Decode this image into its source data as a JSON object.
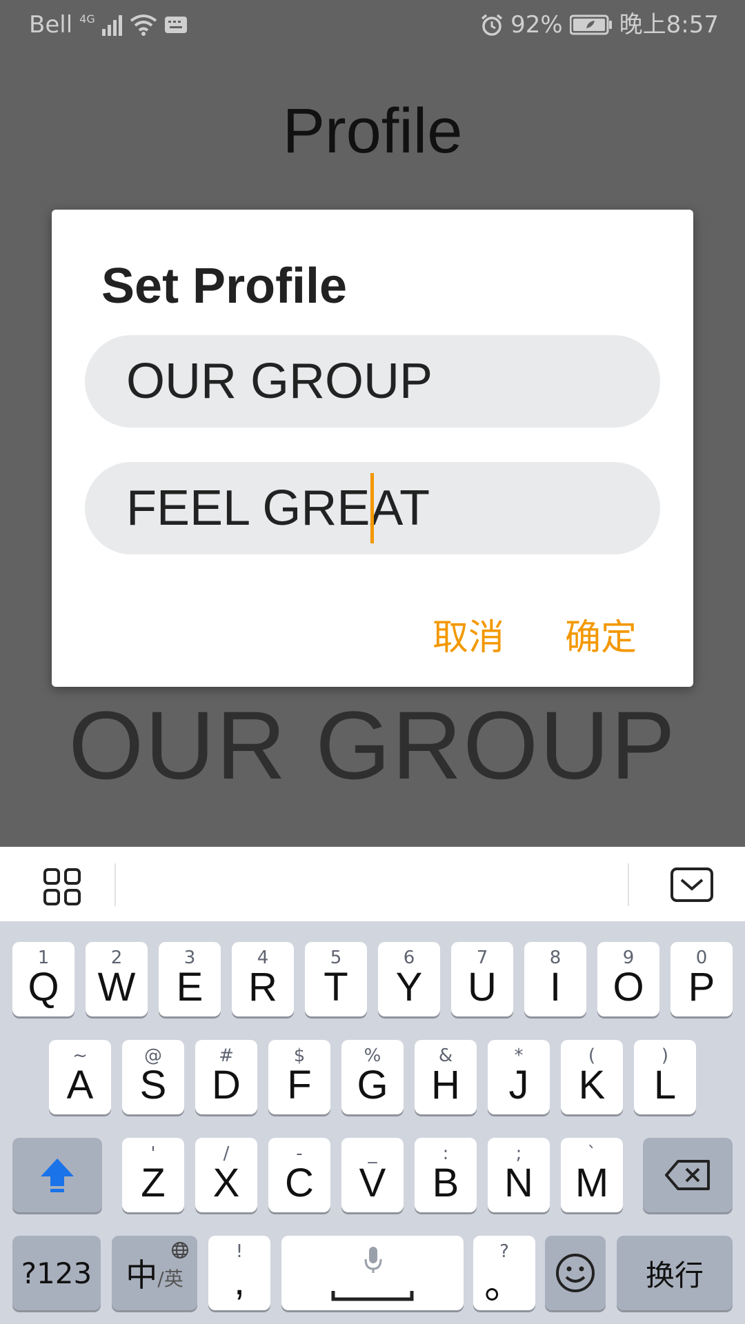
{
  "status_bar": {
    "carrier": "Bell",
    "network": "4G",
    "battery_percent": "92%",
    "time": "晚上8:57",
    "icons": [
      "signal-icon",
      "wifi-icon",
      "keyboard-notification-icon",
      "alarm-icon",
      "battery-icon"
    ]
  },
  "page": {
    "title": "Profile",
    "profile_text": "OUR GROUP"
  },
  "dialog": {
    "title": "Set Profile",
    "field_1_value": "OUR GROUP",
    "field_2_value": "FEEL GREAT",
    "cancel_label": "取消",
    "ok_label": "确定"
  },
  "colors": {
    "accent": "#f39800",
    "field_background": "#e8eaec",
    "overlay": "#626262",
    "shift_active": "#1a73e8"
  },
  "keyboard": {
    "toolbar_icons": [
      "grid-icon",
      "hide-keyboard-icon"
    ],
    "row1": [
      {
        "main": "Q",
        "sub": "1"
      },
      {
        "main": "W",
        "sub": "2"
      },
      {
        "main": "E",
        "sub": "3"
      },
      {
        "main": "R",
        "sub": "4"
      },
      {
        "main": "T",
        "sub": "5"
      },
      {
        "main": "Y",
        "sub": "6"
      },
      {
        "main": "U",
        "sub": "7"
      },
      {
        "main": "I",
        "sub": "8"
      },
      {
        "main": "O",
        "sub": "9"
      },
      {
        "main": "P",
        "sub": "0"
      }
    ],
    "row2": [
      {
        "main": "A",
        "sub": "~"
      },
      {
        "main": "S",
        "sub": "@"
      },
      {
        "main": "D",
        "sub": "#"
      },
      {
        "main": "F",
        "sub": "$"
      },
      {
        "main": "G",
        "sub": "%"
      },
      {
        "main": "H",
        "sub": "&"
      },
      {
        "main": "J",
        "sub": "*"
      },
      {
        "main": "K",
        "sub": "("
      },
      {
        "main": "L",
        "sub": ")"
      }
    ],
    "row3": [
      {
        "main": "Z",
        "sub": "'"
      },
      {
        "main": "X",
        "sub": "/"
      },
      {
        "main": "C",
        "sub": "-"
      },
      {
        "main": "V",
        "sub": "_"
      },
      {
        "main": "B",
        "sub": ":"
      },
      {
        "main": "N",
        "sub": ";"
      },
      {
        "main": "M",
        "sub": "`"
      }
    ],
    "numbers_label": "?123",
    "lang_label_main": "中",
    "lang_label_sub": "/英",
    "comma_main": ",",
    "comma_sub": "!",
    "period_main": "。",
    "period_sub": "?",
    "enter_label": "换行"
  }
}
